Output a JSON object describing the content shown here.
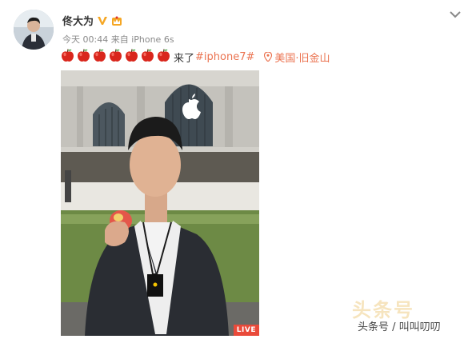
{
  "post": {
    "author": "佟大为",
    "meta": "今天 00:44 来自 iPhone 6s",
    "text": "来了",
    "hashtag": "#iphone7#",
    "location": "美国·旧金山",
    "apple_count": 7,
    "live_label": "LIVE"
  },
  "watermark": {
    "logo_text": "头条号",
    "source": "头条号 / 叫叫叨叨"
  },
  "colors": {
    "link": "#eb7350",
    "live": "#e94a3a",
    "verify": "#f5a623"
  },
  "icons": {
    "verify": "verified-v-icon",
    "vip": "vip-crown-icon",
    "collapse": "chevron-down-icon",
    "location": "location-pin-icon",
    "emoji": "apple-emoji-icon"
  }
}
